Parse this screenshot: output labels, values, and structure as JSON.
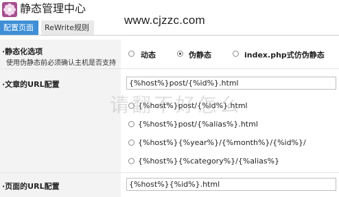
{
  "header": {
    "title": "静态管理中心",
    "site_url": "www.cjzzc.com"
  },
  "tabs": [
    {
      "label": "配置页面",
      "active": true
    },
    {
      "label": "ReWrite规则",
      "active": false
    }
  ],
  "static_mode": {
    "label": "·静态化选项",
    "hint": "使用伪静态前必须确认主机是否支持",
    "options": [
      {
        "label": "动态",
        "checked": false
      },
      {
        "label": "伪静态",
        "checked": true
      },
      {
        "label": "index.php式仿伪静态",
        "checked": false
      }
    ]
  },
  "article_url": {
    "label": "·文章的URL配置",
    "value": "{%host%}post/{%id%}.html",
    "options": [
      {
        "label": "{%host%}post/{%id%}.html",
        "checked": false
      },
      {
        "label": "{%host%}post/{%alias%}.html",
        "checked": false
      },
      {
        "label": "{%host%}{%year%}/{%month%}/{%id%}/",
        "checked": false
      },
      {
        "label": "{%host%}{%category%}/{%alias%}",
        "checked": false
      }
    ]
  },
  "page_url": {
    "label": "·页面的URL配置",
    "value": "{%host%}{%id%}.html"
  },
  "watermark": {
    "overlay_text": "请翻不好怎么"
  }
}
